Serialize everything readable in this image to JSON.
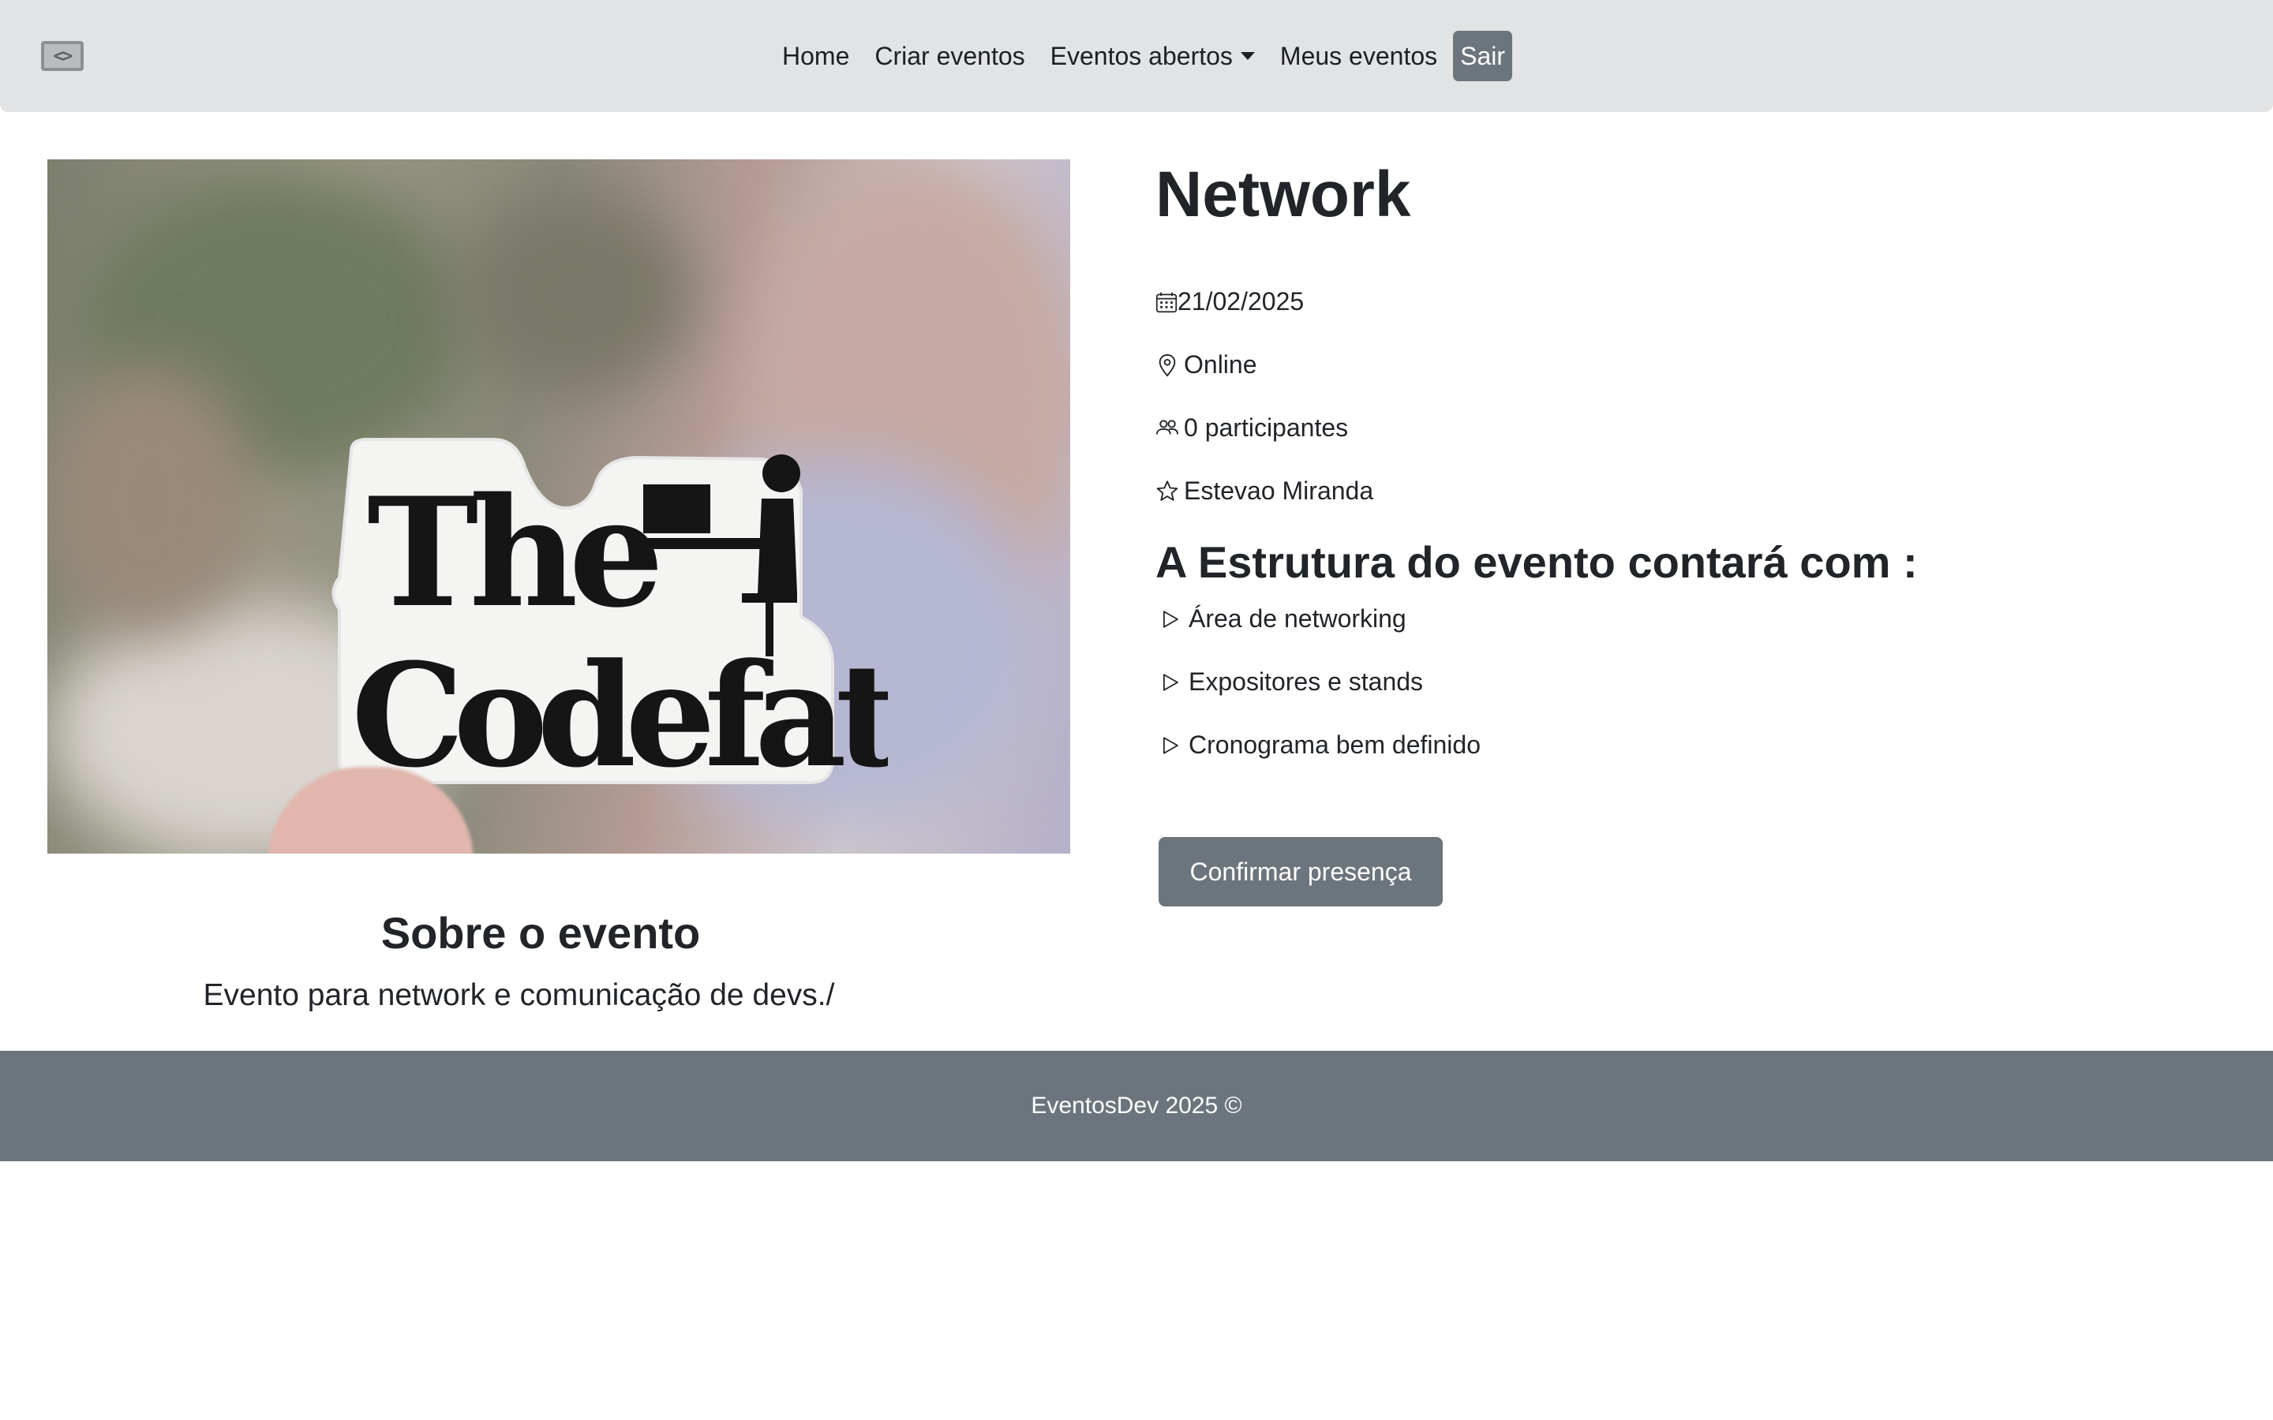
{
  "nav": {
    "logo_icon": "code-brackets-logo",
    "links": [
      "Home",
      "Criar eventos",
      "Eventos abertos",
      "Meus eventos"
    ],
    "logout_label": "Sair"
  },
  "event": {
    "title": "Network",
    "date": "21/02/2025",
    "location": "Online",
    "participants": "0 participantes",
    "organizer": "Estevao Miranda",
    "image_alt_text": "The Codefather"
  },
  "structure": {
    "title": "A Estrutura do evento contará com :",
    "items": [
      "Área de networking",
      "Expositores e stands",
      "Cronograma bem definido"
    ]
  },
  "actions": {
    "confirm_label": "Confirmar presença"
  },
  "about": {
    "title": "Sobre o evento",
    "description": "Evento para network e comunicação de devs./"
  },
  "footer": {
    "text": "EventosDev 2025 ©"
  },
  "colors": {
    "navbar_bg": "#e2e3e5",
    "secondary": "#6c757d",
    "text": "#212529"
  }
}
